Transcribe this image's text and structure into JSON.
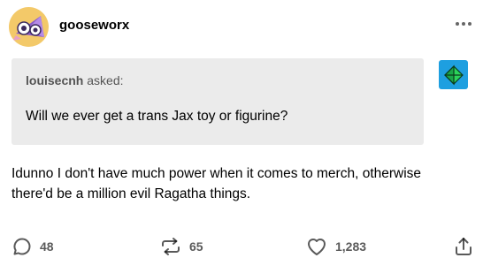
{
  "post": {
    "blog_name": "gooseworx",
    "more_icon": "more-dots-icon",
    "ask": {
      "asker_name": "louisecnh",
      "asked_label": " asked:",
      "question": "Will we ever get a trans Jax toy or figurine?"
    },
    "answer": "Idunno I don't have much power when it comes to merch, otherwise there'd be a million evil Ragatha things.",
    "actions": {
      "replies": "48",
      "reblogs": "65",
      "likes": "1,283"
    },
    "colors": {
      "ask_background": "#ebebeb",
      "asker_avatar": "#1e9fe0",
      "avatar_background": "#f3c969",
      "avatar_accent": "#8a5cc7"
    }
  }
}
